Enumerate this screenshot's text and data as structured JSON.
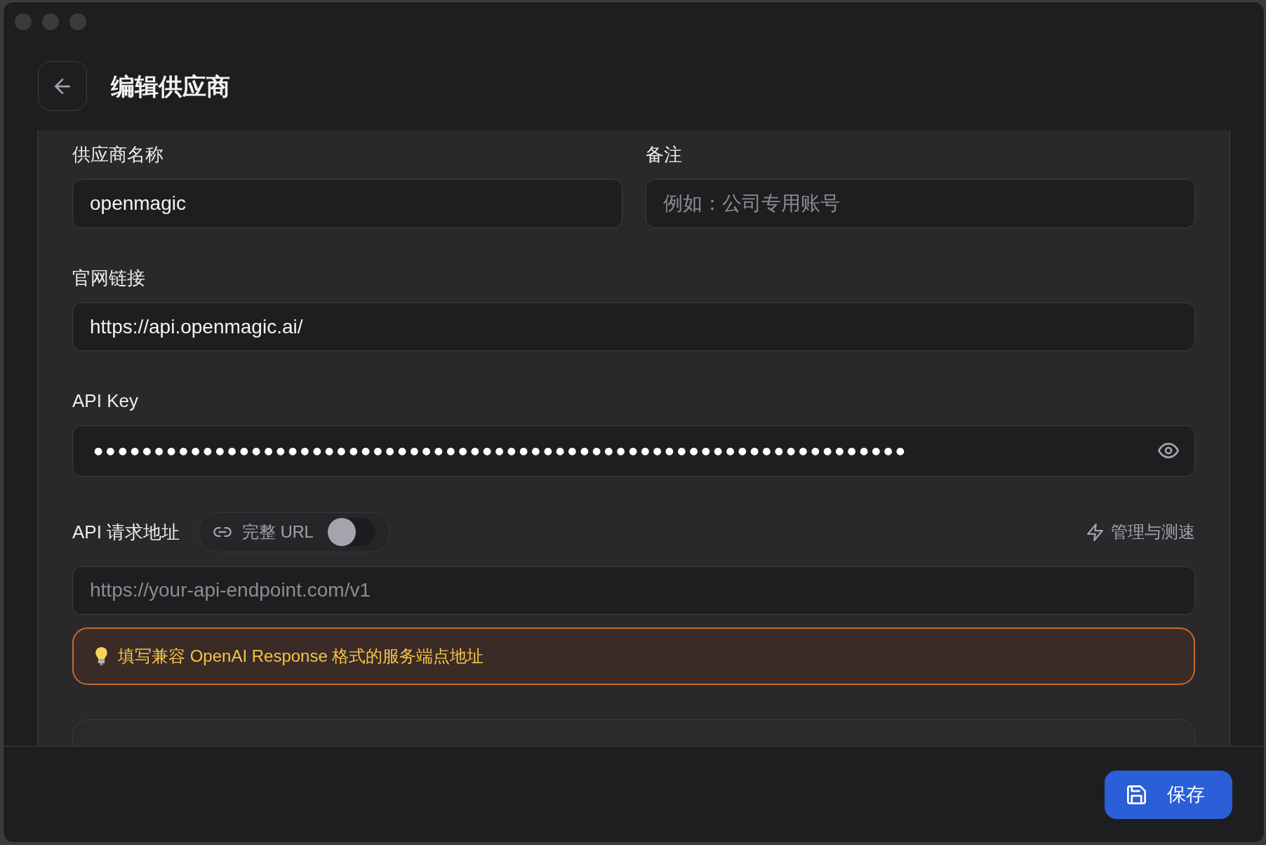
{
  "header": {
    "title": "编辑供应商"
  },
  "basic_fields": [
    {
      "label": "供应商名称",
      "value": "openmagic"
    },
    {
      "label": "备注",
      "placeholder": "例如：公司专用账号"
    }
  ],
  "website": {
    "label": "官网链接",
    "value": "https://api.openmagic.ai/"
  },
  "api_key": {
    "label": "API Key",
    "value": "●●●●●●●●●●●●●●●●●●●●●●●●●●●●●●●●●●●●●●●●●●●●●●●●●●●●●●●●●●●●●●●●●●●"
  },
  "api_endpoint": {
    "label": "API 请求地址",
    "full_url": {
      "label": "完整 URL",
      "on": false
    },
    "manage_link": "管理与测速",
    "placeholder": "https://your-api-endpoint.com/v1",
    "hint": "填写兼容 OpenAI Response 格式的服务端点地址"
  },
  "footer": {
    "save_button": "保存"
  }
}
